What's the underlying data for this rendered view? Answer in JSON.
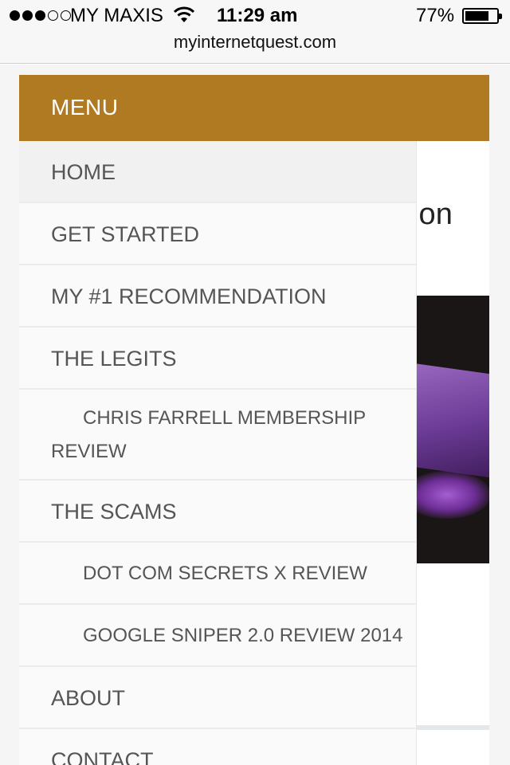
{
  "status_bar": {
    "carrier": "MY MAXIS",
    "time": "11:29 am",
    "battery_percent_text": "77%",
    "battery_level": 0.77,
    "signal_bars_filled": 3,
    "signal_bars_total": 5,
    "url": "myinternetquest.com"
  },
  "page": {
    "heading_fragment": "s on"
  },
  "menu": {
    "title": "MENU",
    "accent_color": "#b07a22",
    "items": [
      {
        "label": "HOME"
      },
      {
        "label": "GET STARTED"
      },
      {
        "label": "MY #1 RECOMMENDATION"
      },
      {
        "label": "THE LEGITS"
      },
      {
        "label": "CHRIS FARRELL MEMBERSHIP REVIEW"
      },
      {
        "label": "THE SCAMS"
      },
      {
        "label": "DOT COM SECRETS X REVIEW"
      },
      {
        "label": "GOOGLE SNIPER 2.0 REVIEW 2014"
      },
      {
        "label": "ABOUT"
      },
      {
        "label": "CONTACT"
      }
    ]
  }
}
